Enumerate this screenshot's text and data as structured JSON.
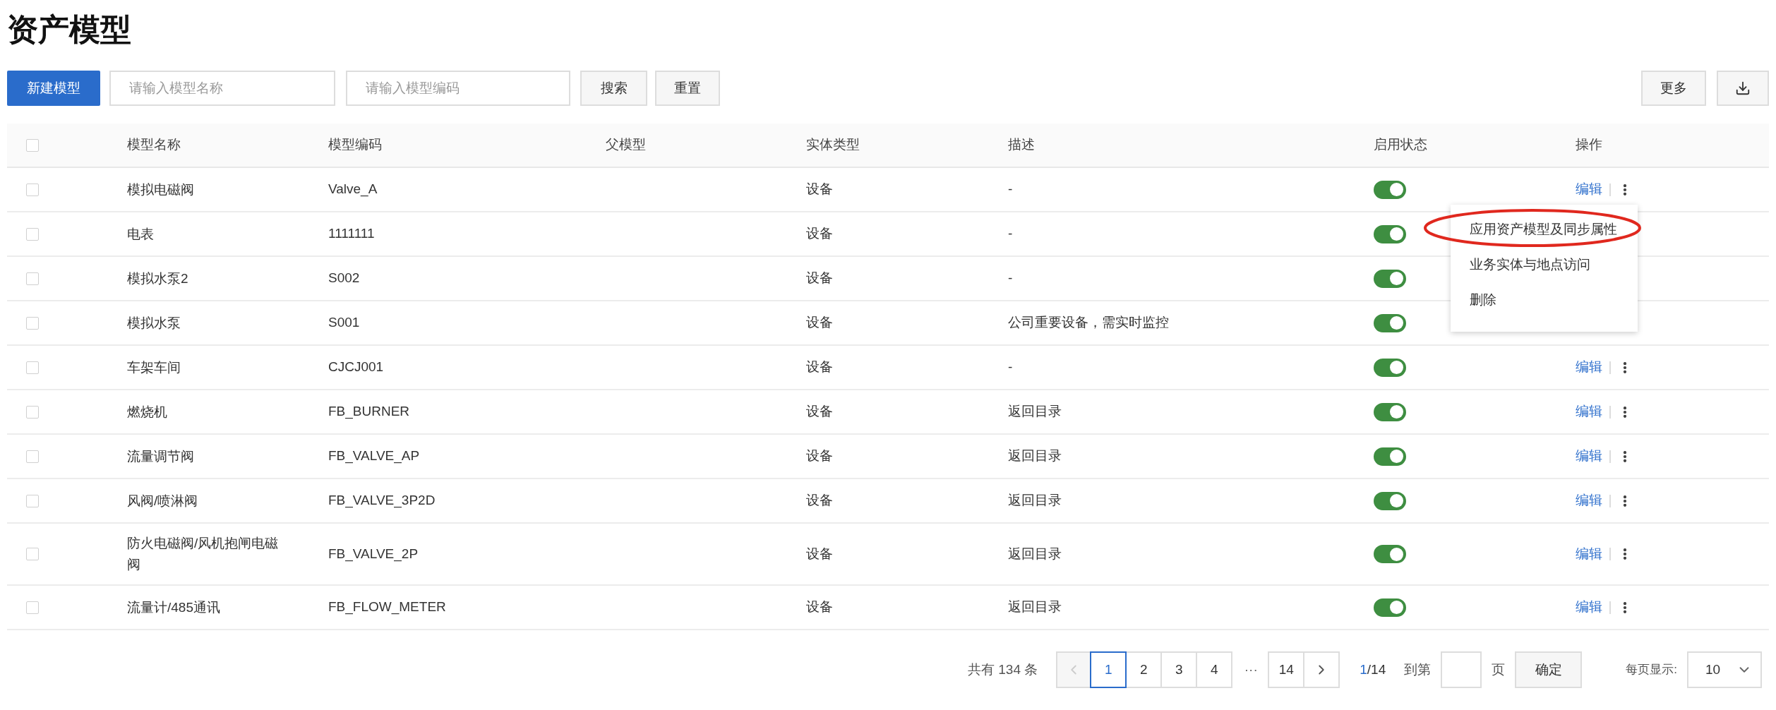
{
  "title": "资产模型",
  "toolbar": {
    "new_button": "新建模型",
    "name_field": {
      "placeholder": "请输入模型名称"
    },
    "code_field": {
      "placeholder": "请输入模型编码"
    },
    "search_button": "搜索",
    "reset_button": "重置",
    "more_button": "更多"
  },
  "table": {
    "select_all_checked": false,
    "columns": [
      "模型名称",
      "模型编码",
      "父模型",
      "实体类型",
      "描述",
      "启用状态",
      "操作"
    ],
    "rows": [
      {
        "checked": false,
        "name": "模拟电磁阀",
        "code": "Valve_A",
        "type": "设备",
        "description": "-",
        "on": true,
        "edit": "编辑",
        "more": true
      },
      {
        "checked": false,
        "name": "电表",
        "code": "1111111",
        "type": "设备",
        "description": "-",
        "on": true
      },
      {
        "checked": false,
        "name": "模拟水泵2",
        "code": "S002",
        "type": "设备",
        "description": "-",
        "on": true
      },
      {
        "checked": false,
        "name": "模拟水泵",
        "code": "S001",
        "type": "设备",
        "description": "公司重要设备，需实时监控",
        "on": true
      },
      {
        "checked": false,
        "name": "车架车间",
        "code": "CJCJ001",
        "type": "设备",
        "description": "-",
        "on": true,
        "edit": "编辑",
        "more": true
      },
      {
        "checked": false,
        "name": "燃烧机",
        "code": "FB_BURNER",
        "type": "设备",
        "description": "返回目录",
        "on": true,
        "edit": "编辑",
        "more": true
      },
      {
        "checked": false,
        "name": "流量调节阀",
        "code": "FB_VALVE_AP",
        "type": "设备",
        "description": "返回目录",
        "on": true,
        "edit": "编辑",
        "more": true
      },
      {
        "checked": false,
        "name": "风阀/喷淋阀",
        "code": "FB_VALVE_3P2D",
        "type": "设备",
        "description": "返回目录",
        "on": true,
        "edit": "编辑",
        "more": true
      },
      {
        "checked": false,
        "name": "防火电磁阀/风机抱闸电磁阀",
        "code": "FB_VALVE_2P",
        "type": "设备",
        "description": "返回目录",
        "on": true,
        "edit": "编辑",
        "more": true
      },
      {
        "checked": false,
        "name": "流量计/485通讯",
        "code": "FB_FLOW_METER",
        "type": "设备",
        "description": "返回目录",
        "on": true,
        "edit": "编辑",
        "more": true
      }
    ]
  },
  "menu": {
    "items": [
      {
        "label": "应用资产模型及同步属性",
        "highlighted": true
      },
      {
        "label": "业务实体与地点访问",
        "highlighted": false
      },
      {
        "label": "删除",
        "highlighted": false
      }
    ]
  },
  "pagination": {
    "total": "共有 134 条",
    "prev_disabled": true,
    "pages": [
      {
        "label": "1",
        "selected": true
      },
      {
        "label": "2",
        "selected": false
      },
      {
        "label": "3",
        "selected": false
      },
      {
        "label": "4",
        "selected": false
      },
      {
        "label": "···",
        "kind": "ellipsis"
      },
      {
        "label": "14",
        "selected": false
      }
    ],
    "current": "1",
    "count": "/14",
    "goto_label": "到第",
    "page_unit": "页",
    "confirm": "确定",
    "page_size_label": "每页显示:",
    "page_size": "10"
  }
}
